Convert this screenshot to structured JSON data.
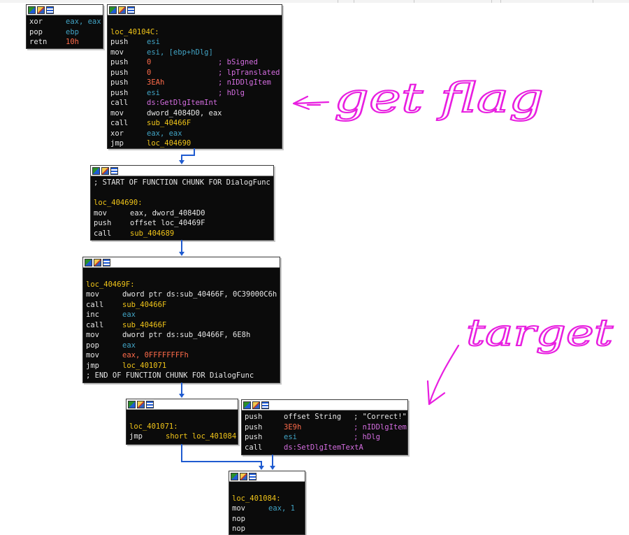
{
  "blocks": {
    "b1": {
      "lines": [
        {
          "c0": "xor",
          "c1": "eax, eax",
          "c1cls": "r"
        },
        {
          "c0": "pop",
          "c1": "ebp",
          "c1cls": "r"
        },
        {
          "c0": "retn",
          "c1": "10h",
          "c1cls": "n"
        }
      ]
    },
    "b2": {
      "lines": [
        {
          "c0": "",
          "c1": ""
        },
        {
          "c0": "loc_40104C:",
          "c0cls": "y"
        },
        {
          "c0": "push",
          "c1": "esi",
          "c1cls": "r"
        },
        {
          "c0": "mov",
          "c1": "esi, [ebp+hDlg]",
          "c1cls": "r"
        },
        {
          "c0": "push",
          "c1": "0",
          "c1cls": "n",
          "c2": "; bSigned"
        },
        {
          "c0": "push",
          "c1": "0",
          "c1cls": "n",
          "c2": "; lpTranslated"
        },
        {
          "c0": "push",
          "c1": "3EAh",
          "c1cls": "n",
          "c2": "; nIDDlgItem"
        },
        {
          "c0": "push",
          "c1": "esi",
          "c1cls": "r",
          "c2": "; hDlg"
        },
        {
          "c0": "call",
          "c1": "ds:GetDlgItemInt",
          "c1cls": "p"
        },
        {
          "c0": "mov",
          "c1": "dword_4084D0, eax",
          "c1cls": "w"
        },
        {
          "c0": "call",
          "c1": "sub_40466F",
          "c1cls": "y"
        },
        {
          "c0": "xor",
          "c1": "eax, eax",
          "c1cls": "r"
        },
        {
          "c0": "jmp",
          "c1": "loc_404690",
          "c1cls": "y"
        }
      ]
    },
    "b3": {
      "lines": [
        {
          "c0": "; START OF FUNCTION CHUNK FOR DialogFunc",
          "c0cls": "w"
        },
        {
          "c0": ""
        },
        {
          "c0": "loc_404690:",
          "c0cls": "y"
        },
        {
          "c0": "mov",
          "c1": "eax, dword_4084D0",
          "c1cls": "w"
        },
        {
          "c0": "push",
          "c1": "offset loc_40469F",
          "c1cls": "w"
        },
        {
          "c0": "call",
          "c1": "sub_404689",
          "c1cls": "y"
        }
      ]
    },
    "b4": {
      "lines": [
        {
          "c0": ""
        },
        {
          "c0": "loc_40469F:",
          "c0cls": "y"
        },
        {
          "c0": "mov",
          "c1": "dword ptr ds:sub_40466F, 0C39000C6h",
          "c1cls": "w"
        },
        {
          "c0": "call",
          "c1": "sub_40466F",
          "c1cls": "y"
        },
        {
          "c0": "inc",
          "c1": "eax",
          "c1cls": "r"
        },
        {
          "c0": "call",
          "c1": "sub_40466F",
          "c1cls": "y"
        },
        {
          "c0": "mov",
          "c1": "dword ptr ds:sub_40466F, 6E8h",
          "c1cls": "w"
        },
        {
          "c0": "pop",
          "c1": "eax",
          "c1cls": "r"
        },
        {
          "c0": "mov",
          "c1": "eax, 0FFFFFFFFh",
          "c1cls": "n"
        },
        {
          "c0": "jmp",
          "c1": "loc_401071",
          "c1cls": "y"
        },
        {
          "c0": "; END OF FUNCTION CHUNK FOR DialogFunc",
          "c0cls": "w"
        }
      ]
    },
    "b5": {
      "lines": [
        {
          "c0": ""
        },
        {
          "c0": "loc_401071:",
          "c0cls": "y"
        },
        {
          "c0": "jmp",
          "c1": "short loc_401084",
          "c1cls": "y"
        }
      ]
    },
    "b6": {
      "lines": [
        {
          "c0": "push",
          "c1": "offset String",
          "c1cls": "w",
          "c2": "; \"Correct!\"",
          "c2cls": "w"
        },
        {
          "c0": "push",
          "c1": "3E9h",
          "c1cls": "n",
          "c2": "; nIDDlgItem"
        },
        {
          "c0": "push",
          "c1": "esi",
          "c1cls": "r",
          "c2": "; hDlg"
        },
        {
          "c0": "call",
          "c1": "ds:SetDlgItemTextA",
          "c1cls": "p"
        }
      ]
    },
    "b7": {
      "lines": [
        {
          "c0": ""
        },
        {
          "c0": "loc_401084:",
          "c0cls": "y"
        },
        {
          "c0": "mov",
          "c1": "eax, 1",
          "c1cls": "r"
        },
        {
          "c0": "nop"
        },
        {
          "c0": "nop"
        }
      ]
    }
  },
  "annotations": {
    "get_flag": "get flag",
    "target": "target",
    "ink_color": "#e81ee0"
  },
  "colors": {
    "edge": "#1f5bd0"
  }
}
